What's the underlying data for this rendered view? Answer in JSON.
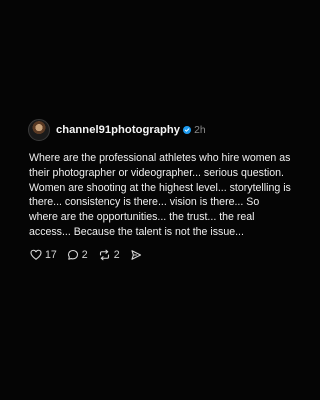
{
  "post": {
    "username": "channel91photography",
    "timestamp": "2h",
    "text": "Where are the professional athletes who hire women as their photographer or videographer... serious question. Women are shooting at the highest level... storytelling is there... consistency is there... vision is there... So where are the opportunities... the trust... the real access... Because the talent is not the issue...",
    "verified": true,
    "icons": {
      "avatar": "profile-avatar",
      "verified": "verified-badge-icon",
      "like": "heart-icon",
      "reply": "comment-icon",
      "repost": "repost-icon",
      "share": "send-icon"
    }
  },
  "actions": {
    "likes": "17",
    "replies": "2",
    "reposts": "2"
  },
  "colors": {
    "background": "#050505",
    "text": "#f0f0f0",
    "muted": "#8a8a8a",
    "verified": "#1d9bf0"
  }
}
